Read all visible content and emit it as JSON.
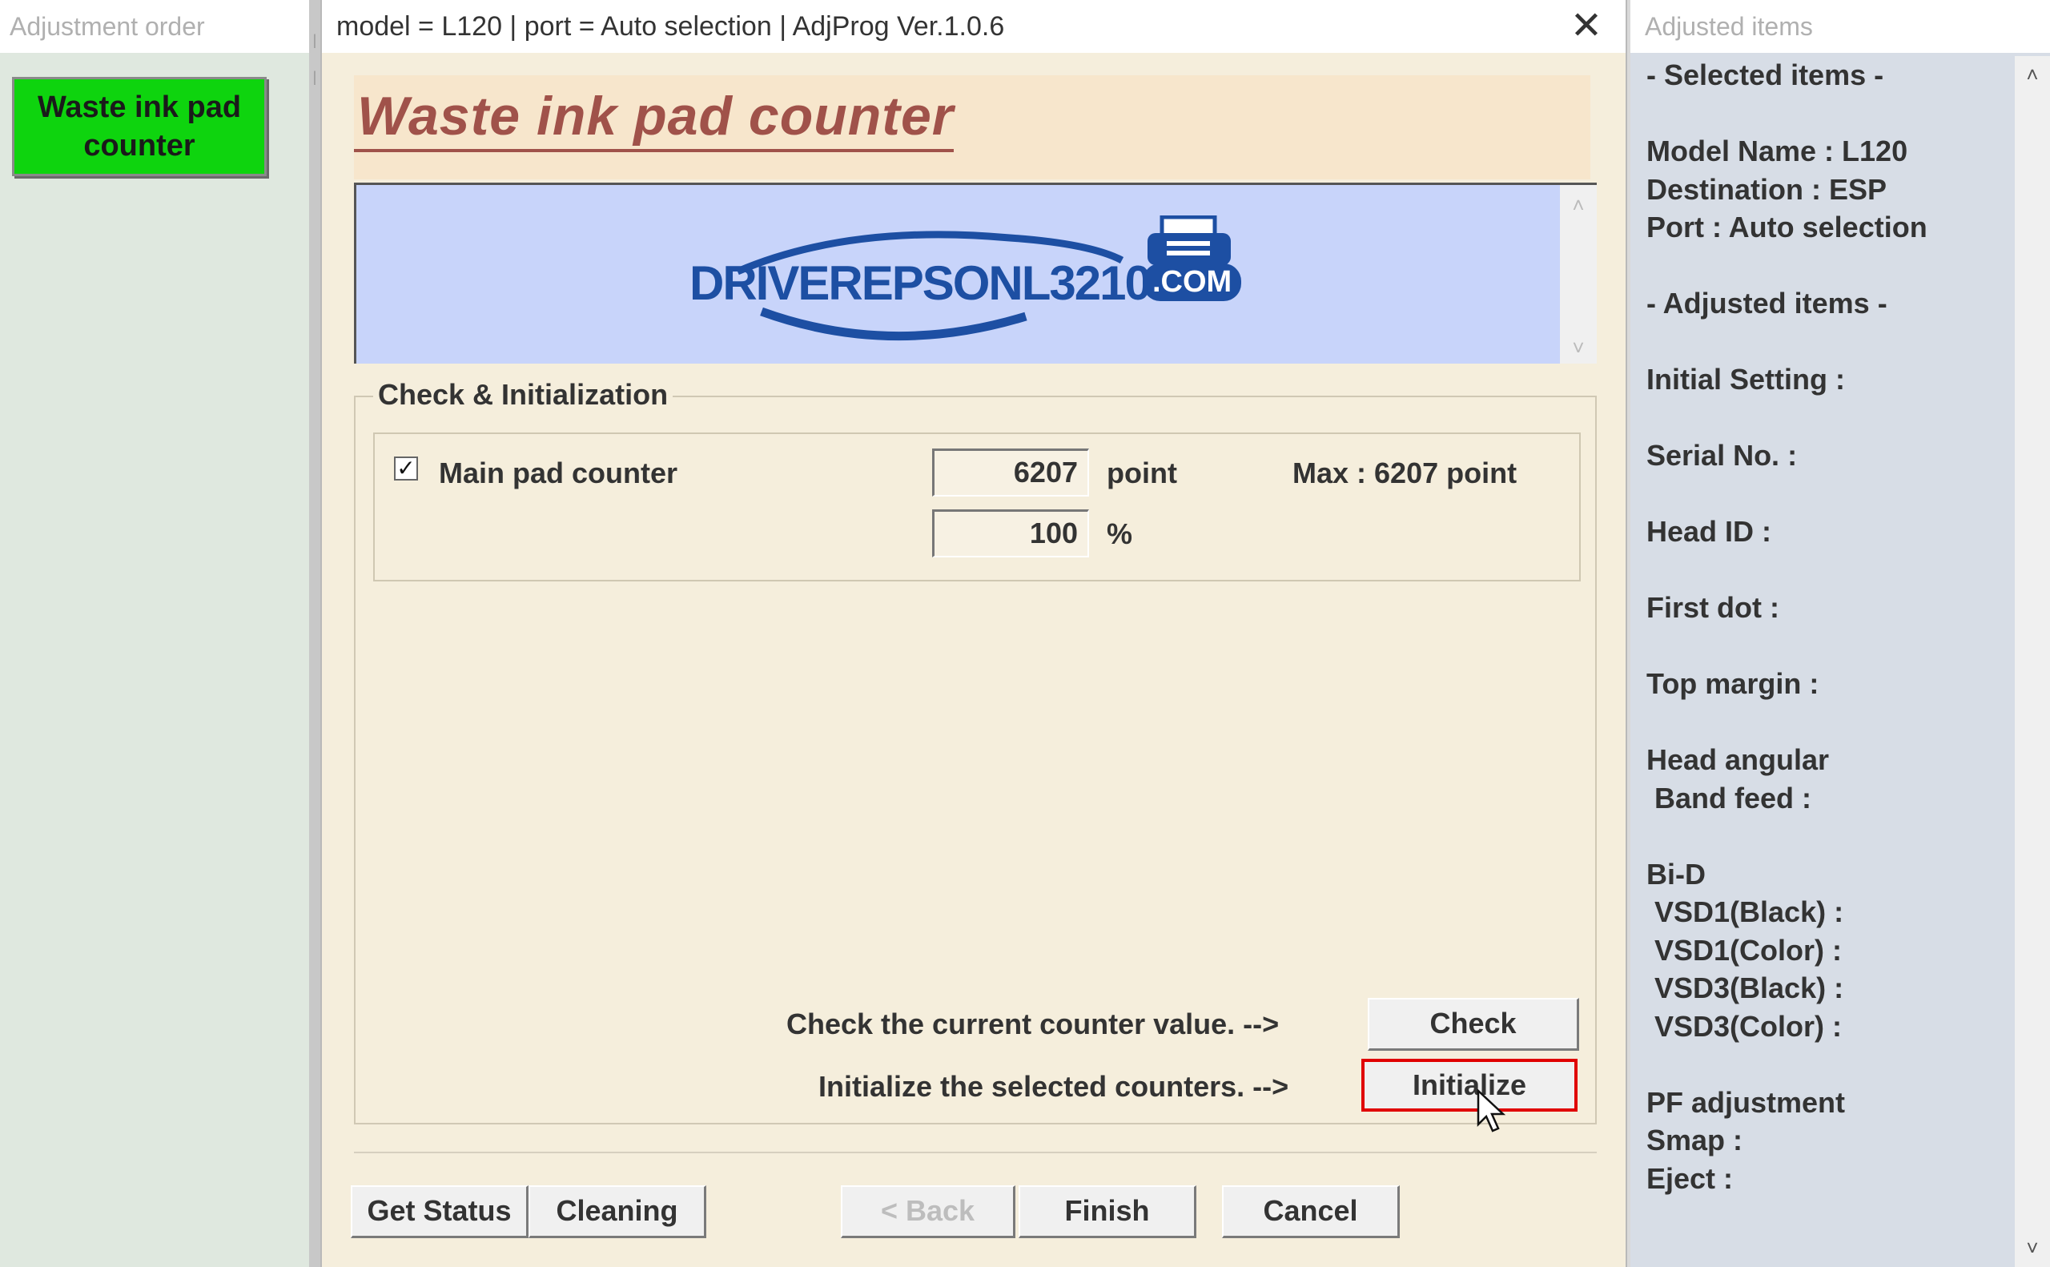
{
  "left_panel": {
    "title": "Adjustment order",
    "items": [
      {
        "label": "Waste ink pad counter",
        "color": "#0ed40e"
      }
    ]
  },
  "window": {
    "title": "model = L120 | port = Auto selection | AdjProg Ver.1.0.6",
    "close_icon": "close-icon",
    "heading": "Waste ink pad counter",
    "banner": {
      "logo_text": "DRIVEREPSONL3210",
      "logo_suffix": ".COM",
      "logo_icon": "printer-icon"
    }
  },
  "check_init": {
    "group_label": "Check & Initialization",
    "main_pad": {
      "checked": true,
      "label": "Main pad counter",
      "value": "6207",
      "unit": "point",
      "max_label": "Max : 6207 point",
      "percent": "100",
      "percent_unit": "%"
    },
    "check_hint": "Check the current counter value. -->",
    "check_button": "Check",
    "init_hint": "Initialize the selected counters. -->",
    "init_button": "Initialize"
  },
  "footer": {
    "get_status": "Get Status",
    "cleaning": "Cleaning",
    "back": "< Back",
    "finish": "Finish",
    "cancel": "Cancel"
  },
  "right_panel": {
    "title": "Adjusted items",
    "lines": [
      "- Selected items -",
      "",
      "Model Name : L120",
      "Destination : ESP",
      "Port : Auto selection",
      "",
      "- Adjusted items -",
      "",
      "Initial Setting :",
      "",
      "Serial No. :",
      "",
      "Head ID :",
      "",
      "First dot :",
      "",
      "Top margin :",
      "",
      "Head angular",
      " Band feed :",
      "",
      "Bi-D",
      " VSD1(Black) :",
      " VSD1(Color) :",
      " VSD3(Black) :",
      " VSD3(Color) :",
      "",
      "PF adjustment",
      "Smap :",
      "Eject :"
    ]
  },
  "colors": {
    "accent_red": "#e00000",
    "heading": "#a0524a",
    "logo_blue": "#1d4fa3"
  }
}
